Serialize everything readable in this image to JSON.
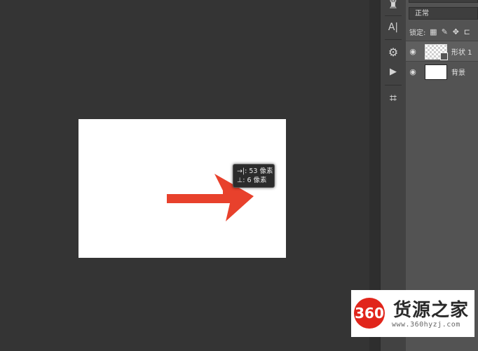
{
  "canvas": {
    "tooltip": {
      "width_line": "→|: 53 像素",
      "height_line": "⊥:  6 像素"
    },
    "arrow_color": "#e8412c"
  },
  "tools": [
    {
      "name": "stamp-icon",
      "glyph": "♜"
    },
    {
      "name": "type-vertical-icon",
      "glyph": "A|"
    },
    {
      "name": "3d-object-icon",
      "glyph": "⚙"
    },
    {
      "name": "play-icon",
      "glyph": "▶"
    },
    {
      "name": "crop-icon",
      "glyph": "⌗"
    }
  ],
  "layers_panel": {
    "blend_mode": "正常",
    "lock_label": "锁定:",
    "layers": [
      {
        "name": "形状 1",
        "selected": true
      },
      {
        "name": "背景",
        "selected": false
      }
    ]
  },
  "watermark": {
    "badge": "360",
    "title": "货源之家",
    "url": "www.360hyzj.com"
  }
}
